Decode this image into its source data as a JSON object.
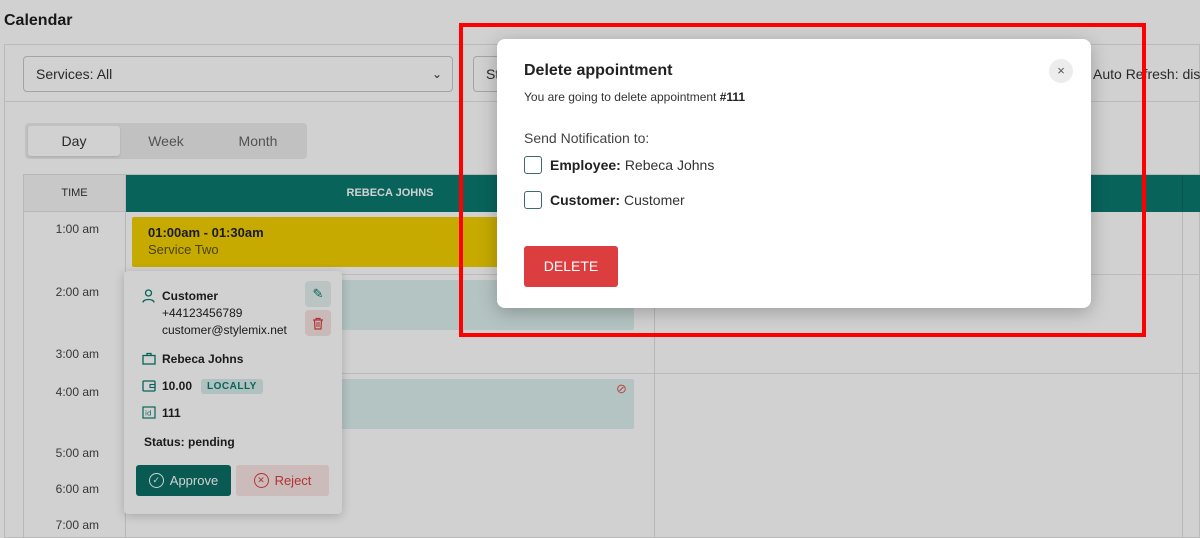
{
  "page": {
    "title": "Calendar"
  },
  "filters": {
    "services": "Services: All",
    "status": "Sta",
    "auto_refresh": "Auto Refresh: dis"
  },
  "view_tabs": [
    {
      "label": "Day",
      "active": true
    },
    {
      "label": "Week",
      "active": false
    },
    {
      "label": "Month",
      "active": false
    }
  ],
  "grid": {
    "time_header": "TIME",
    "employee_header": "REBECA JOHNS",
    "times": [
      "1:00 am",
      "2:00 am",
      "3:00 am",
      "4:00 am",
      "5:00 am",
      "6:00 am",
      "7:00 am"
    ],
    "appointment": {
      "time": "01:00am - 01:30am",
      "service": "Service Two",
      "color": "#f2d000"
    }
  },
  "popover": {
    "customer_name": "Customer",
    "customer_phone": "+44123456789",
    "customer_email": "customer@stylemix.net",
    "employee": "Rebeca Johns",
    "price": "10.00",
    "location_badge": "LOCALLY",
    "appointment_id": "111",
    "status": "Status: pending",
    "approve_label": "Approve",
    "reject_label": "Reject",
    "icons": [
      "user-icon",
      "briefcase-icon",
      "wallet-icon",
      "id-icon",
      "edit-icon",
      "trash-icon"
    ]
  },
  "modal": {
    "title": "Delete appointment",
    "subtitle_prefix": "You are going to delete appointment",
    "subtitle_id": "#111",
    "notify_label": "Send Notification to:",
    "employee_label": "Employee:",
    "employee_value": "Rebeca Johns",
    "customer_label": "Customer:",
    "customer_value": "Customer",
    "delete_label": "DELETE",
    "close_icon": "×"
  },
  "colors": {
    "accent": "#0a7a70",
    "danger": "#dc3e40",
    "highlight": "#ff0000"
  }
}
